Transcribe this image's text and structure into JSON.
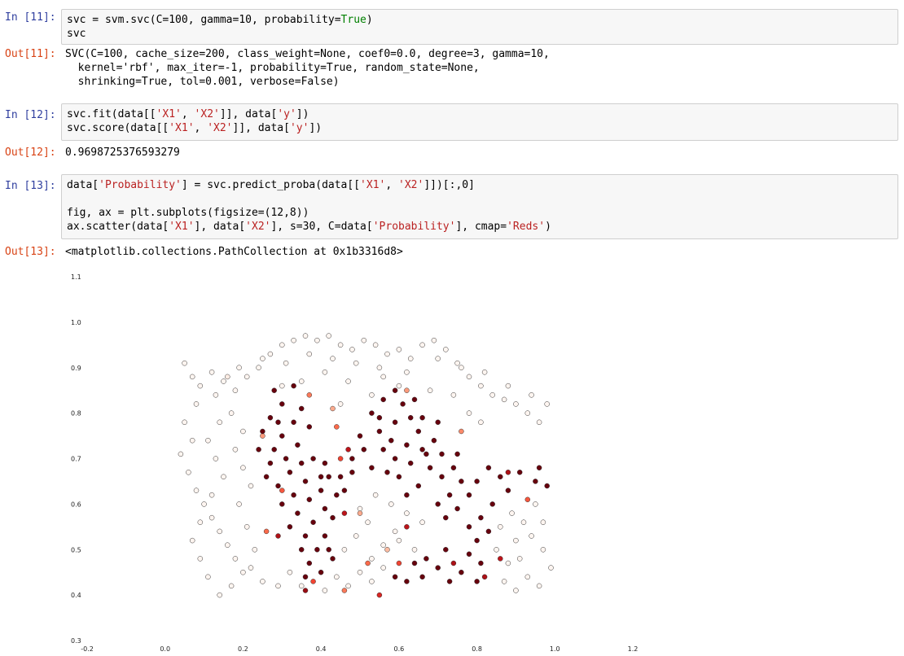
{
  "cells": [
    {
      "in_prompt": "In [11]:",
      "code": [
        [
          {
            "t": "svc = svm.svc(C=100, gamma=10, probability="
          },
          {
            "t": "True",
            "c": "kw"
          },
          {
            "t": ")"
          }
        ],
        [
          {
            "t": "svc"
          }
        ]
      ],
      "out_prompt": "Out[11]:",
      "output": [
        "SVC(C=100, cache_size=200, class_weight=None, coef0=0.0, degree=3, gamma=10,",
        "  kernel='rbf', max_iter=-1, probability=True, random_state=None,",
        "  shrinking=True, tol=0.001, verbose=False)"
      ]
    },
    {
      "in_prompt": "In [12]:",
      "code": [
        [
          {
            "t": "svc.fit(data[["
          },
          {
            "t": "'X1'",
            "c": "st"
          },
          {
            "t": ", "
          },
          {
            "t": "'X2'",
            "c": "st"
          },
          {
            "t": "]], data["
          },
          {
            "t": "'y'",
            "c": "st"
          },
          {
            "t": "])"
          }
        ],
        [
          {
            "t": "svc.score(data[["
          },
          {
            "t": "'X1'",
            "c": "st"
          },
          {
            "t": ", "
          },
          {
            "t": "'X2'",
            "c": "st"
          },
          {
            "t": "]], data["
          },
          {
            "t": "'y'",
            "c": "st"
          },
          {
            "t": "])"
          }
        ]
      ],
      "out_prompt": "Out[12]:",
      "output": [
        "0.9698725376593279"
      ]
    },
    {
      "in_prompt": "In [13]:",
      "code": [
        [
          {
            "t": "data["
          },
          {
            "t": "'Probability'",
            "c": "st"
          },
          {
            "t": "] = svc.predict_proba(data[["
          },
          {
            "t": "'X1'",
            "c": "st"
          },
          {
            "t": ", "
          },
          {
            "t": "'X2'",
            "c": "st"
          },
          {
            "t": "]])[:,0]"
          }
        ],
        [
          {
            "t": ""
          }
        ],
        [
          {
            "t": "fig, ax = plt.subplots(figsize=(12,8))"
          }
        ],
        [
          {
            "t": "ax.scatter(data["
          },
          {
            "t": "'X1'",
            "c": "st"
          },
          {
            "t": "], data["
          },
          {
            "t": "'X2'",
            "c": "st"
          },
          {
            "t": "], s=30, C=data["
          },
          {
            "t": "'Probability'",
            "c": "st"
          },
          {
            "t": "], cmap="
          },
          {
            "t": "'Reds'",
            "c": "st"
          },
          {
            "t": ")"
          }
        ]
      ],
      "out_prompt": "Out[13]:",
      "output": [
        "<matplotlib.collections.PathCollection at 0x1b3316d8>"
      ]
    }
  ],
  "chart_data": {
    "type": "scatter",
    "title": "",
    "xlabel": "",
    "ylabel": "",
    "xlim": [
      -0.2,
      1.2
    ],
    "ylim": [
      0.3,
      1.1
    ],
    "xticks": [
      "-0.2",
      "0.0",
      "0.2",
      "0.4",
      "0.6",
      "0.8",
      "1.0",
      "1.2"
    ],
    "yticks": [
      "0.3",
      "0.4",
      "0.5",
      "0.6",
      "0.7",
      "0.8",
      "0.9",
      "1.0",
      "1.1"
    ],
    "grid": false,
    "colormap": "Reds",
    "note_color_low": "#fff5f0",
    "note_color_high": "#67000d",
    "points": [
      [
        0.05,
        0.91,
        0
      ],
      [
        0.07,
        0.88,
        0
      ],
      [
        0.09,
        0.86,
        0
      ],
      [
        0.12,
        0.89,
        0
      ],
      [
        0.15,
        0.87,
        0
      ],
      [
        0.18,
        0.85,
        0
      ],
      [
        0.21,
        0.88,
        0
      ],
      [
        0.24,
        0.9,
        0
      ],
      [
        0.27,
        0.93,
        0
      ],
      [
        0.3,
        0.95,
        0
      ],
      [
        0.33,
        0.96,
        0
      ],
      [
        0.36,
        0.97,
        0
      ],
      [
        0.39,
        0.96,
        0
      ],
      [
        0.42,
        0.97,
        0
      ],
      [
        0.45,
        0.95,
        0
      ],
      [
        0.48,
        0.94,
        0
      ],
      [
        0.51,
        0.96,
        0
      ],
      [
        0.54,
        0.95,
        0
      ],
      [
        0.57,
        0.93,
        0
      ],
      [
        0.6,
        0.94,
        0
      ],
      [
        0.63,
        0.92,
        0
      ],
      [
        0.66,
        0.95,
        0
      ],
      [
        0.69,
        0.96,
        0
      ],
      [
        0.72,
        0.94,
        0
      ],
      [
        0.75,
        0.91,
        0
      ],
      [
        0.78,
        0.88,
        0
      ],
      [
        0.81,
        0.86,
        0
      ],
      [
        0.84,
        0.84,
        0
      ],
      [
        0.87,
        0.83,
        0
      ],
      [
        0.9,
        0.82,
        0
      ],
      [
        0.93,
        0.8,
        0
      ],
      [
        0.96,
        0.78,
        0
      ],
      [
        0.98,
        0.82,
        0
      ],
      [
        0.94,
        0.84,
        0
      ],
      [
        0.88,
        0.86,
        0
      ],
      [
        0.82,
        0.89,
        0
      ],
      [
        0.76,
        0.9,
        0
      ],
      [
        0.7,
        0.92,
        0
      ],
      [
        0.62,
        0.89,
        0
      ],
      [
        0.55,
        0.9,
        0
      ],
      [
        0.49,
        0.91,
        0
      ],
      [
        0.43,
        0.92,
        0
      ],
      [
        0.37,
        0.93,
        0
      ],
      [
        0.31,
        0.91,
        0
      ],
      [
        0.25,
        0.92,
        0
      ],
      [
        0.19,
        0.9,
        0
      ],
      [
        0.13,
        0.84,
        0
      ],
      [
        0.08,
        0.82,
        0
      ],
      [
        0.05,
        0.78,
        0
      ],
      [
        0.07,
        0.74,
        0
      ],
      [
        0.04,
        0.71,
        0
      ],
      [
        0.06,
        0.67,
        0
      ],
      [
        0.08,
        0.63,
        0
      ],
      [
        0.1,
        0.6,
        0
      ],
      [
        0.12,
        0.57,
        0
      ],
      [
        0.14,
        0.54,
        0
      ],
      [
        0.16,
        0.51,
        0
      ],
      [
        0.18,
        0.48,
        0
      ],
      [
        0.2,
        0.45,
        0
      ],
      [
        0.17,
        0.42,
        0
      ],
      [
        0.14,
        0.4,
        0
      ],
      [
        0.11,
        0.44,
        0
      ],
      [
        0.09,
        0.48,
        0
      ],
      [
        0.07,
        0.52,
        0
      ],
      [
        0.09,
        0.56,
        0
      ],
      [
        0.12,
        0.62,
        0
      ],
      [
        0.15,
        0.66,
        0
      ],
      [
        0.13,
        0.7,
        0
      ],
      [
        0.11,
        0.74,
        0
      ],
      [
        0.14,
        0.78,
        0
      ],
      [
        0.17,
        0.8,
        0
      ],
      [
        0.2,
        0.76,
        0
      ],
      [
        0.18,
        0.72,
        0
      ],
      [
        0.2,
        0.68,
        0
      ],
      [
        0.22,
        0.64,
        0
      ],
      [
        0.19,
        0.6,
        0
      ],
      [
        0.21,
        0.55,
        0
      ],
      [
        0.23,
        0.5,
        0
      ],
      [
        0.22,
        0.46,
        0
      ],
      [
        0.25,
        0.43,
        0
      ],
      [
        0.29,
        0.42,
        0
      ],
      [
        0.32,
        0.45,
        0
      ],
      [
        0.35,
        0.42,
        0
      ],
      [
        0.41,
        0.41,
        0
      ],
      [
        0.44,
        0.44,
        0
      ],
      [
        0.47,
        0.42,
        0
      ],
      [
        0.5,
        0.45,
        0
      ],
      [
        0.53,
        0.48,
        0
      ],
      [
        0.56,
        0.51,
        0
      ],
      [
        0.59,
        0.54,
        0
      ],
      [
        0.52,
        0.56,
        0
      ],
      [
        0.49,
        0.53,
        0
      ],
      [
        0.46,
        0.5,
        0
      ],
      [
        0.5,
        0.59,
        0
      ],
      [
        0.54,
        0.62,
        0
      ],
      [
        0.58,
        0.6,
        0
      ],
      [
        0.62,
        0.58,
        0
      ],
      [
        0.66,
        0.56,
        0
      ],
      [
        0.6,
        0.52,
        0
      ],
      [
        0.64,
        0.5,
        0
      ],
      [
        0.56,
        0.46,
        0
      ],
      [
        0.53,
        0.43,
        0
      ],
      [
        0.85,
        0.5,
        0
      ],
      [
        0.88,
        0.47,
        0
      ],
      [
        0.9,
        0.52,
        0
      ],
      [
        0.92,
        0.56,
        0
      ],
      [
        0.95,
        0.6,
        0
      ],
      [
        0.97,
        0.5,
        0
      ],
      [
        0.99,
        0.46,
        0
      ],
      [
        0.96,
        0.42,
        0
      ],
      [
        0.93,
        0.44,
        0
      ],
      [
        0.9,
        0.41,
        0
      ],
      [
        0.87,
        0.43,
        0
      ],
      [
        0.91,
        0.48,
        0
      ],
      [
        0.94,
        0.53,
        0
      ],
      [
        0.97,
        0.56,
        0
      ],
      [
        0.86,
        0.55,
        0
      ],
      [
        0.89,
        0.58,
        0
      ],
      [
        0.56,
        0.88,
        0
      ],
      [
        0.47,
        0.87,
        0
      ],
      [
        0.41,
        0.89,
        0
      ],
      [
        0.35,
        0.87,
        0
      ],
      [
        0.3,
        0.86,
        0
      ],
      [
        0.45,
        0.82,
        0
      ],
      [
        0.53,
        0.84,
        0
      ],
      [
        0.6,
        0.86,
        0
      ],
      [
        0.68,
        0.85,
        0
      ],
      [
        0.74,
        0.84,
        0
      ],
      [
        0.78,
        0.8,
        0
      ],
      [
        0.81,
        0.78,
        0
      ],
      [
        0.16,
        0.88,
        0.05
      ],
      [
        0.43,
        0.81,
        0.3
      ],
      [
        0.25,
        0.75,
        0.35
      ],
      [
        0.44,
        0.77,
        0.5
      ],
      [
        0.37,
        0.84,
        0.45
      ],
      [
        0.76,
        0.76,
        0.4
      ],
      [
        0.62,
        0.85,
        0.35
      ],
      [
        0.57,
        0.5,
        0.25
      ],
      [
        0.5,
        0.58,
        0.3
      ],
      [
        0.26,
        0.54,
        0.5
      ],
      [
        0.3,
        0.63,
        0.55
      ],
      [
        0.6,
        0.47,
        0.6
      ],
      [
        0.52,
        0.47,
        0.5
      ],
      [
        0.46,
        0.41,
        0.45
      ],
      [
        0.38,
        0.43,
        0.6
      ],
      [
        0.93,
        0.61,
        0.55
      ],
      [
        0.45,
        0.7,
        0.6
      ],
      [
        0.55,
        0.4,
        0.7
      ],
      [
        0.28,
        0.85,
        1
      ],
      [
        0.3,
        0.82,
        1
      ],
      [
        0.27,
        0.79,
        1
      ],
      [
        0.25,
        0.76,
        1
      ],
      [
        0.28,
        0.72,
        1
      ],
      [
        0.3,
        0.75,
        1
      ],
      [
        0.33,
        0.78,
        1
      ],
      [
        0.35,
        0.81,
        1
      ],
      [
        0.37,
        0.77,
        1
      ],
      [
        0.34,
        0.73,
        1
      ],
      [
        0.31,
        0.7,
        1
      ],
      [
        0.27,
        0.69,
        1
      ],
      [
        0.24,
        0.72,
        1
      ],
      [
        0.26,
        0.66,
        1
      ],
      [
        0.29,
        0.64,
        1
      ],
      [
        0.32,
        0.67,
        1
      ],
      [
        0.35,
        0.69,
        1
      ],
      [
        0.38,
        0.7,
        1
      ],
      [
        0.36,
        0.65,
        1
      ],
      [
        0.33,
        0.62,
        1
      ],
      [
        0.3,
        0.6,
        1
      ],
      [
        0.34,
        0.58,
        1
      ],
      [
        0.37,
        0.61,
        1
      ],
      [
        0.4,
        0.63,
        1
      ],
      [
        0.42,
        0.66,
        1
      ],
      [
        0.44,
        0.62,
        1
      ],
      [
        0.41,
        0.59,
        1
      ],
      [
        0.38,
        0.56,
        1
      ],
      [
        0.36,
        0.53,
        1
      ],
      [
        0.39,
        0.5,
        1
      ],
      [
        0.41,
        0.53,
        1
      ],
      [
        0.43,
        0.57,
        1
      ],
      [
        0.46,
        0.63,
        1
      ],
      [
        0.48,
        0.67,
        1
      ],
      [
        0.45,
        0.66,
        1
      ],
      [
        0.37,
        0.47,
        1
      ],
      [
        0.36,
        0.44,
        1
      ],
      [
        0.4,
        0.45,
        1
      ],
      [
        0.43,
        0.48,
        1
      ],
      [
        0.48,
        0.7,
        1
      ],
      [
        0.53,
        0.68,
        1
      ],
      [
        0.56,
        0.72,
        1
      ],
      [
        0.55,
        0.76,
        1
      ],
      [
        0.53,
        0.8,
        1
      ],
      [
        0.56,
        0.83,
        1
      ],
      [
        0.59,
        0.85,
        1
      ],
      [
        0.61,
        0.82,
        1
      ],
      [
        0.63,
        0.79,
        1
      ],
      [
        0.65,
        0.76,
        1
      ],
      [
        0.62,
        0.73,
        1
      ],
      [
        0.59,
        0.7,
        1
      ],
      [
        0.57,
        0.67,
        1
      ],
      [
        0.6,
        0.66,
        1
      ],
      [
        0.63,
        0.69,
        1
      ],
      [
        0.66,
        0.72,
        1
      ],
      [
        0.69,
        0.74,
        1
      ],
      [
        0.71,
        0.71,
        1
      ],
      [
        0.68,
        0.68,
        1
      ],
      [
        0.71,
        0.66,
        1
      ],
      [
        0.74,
        0.68,
        1
      ],
      [
        0.76,
        0.65,
        1
      ],
      [
        0.73,
        0.62,
        1
      ],
      [
        0.7,
        0.6,
        1
      ],
      [
        0.72,
        0.57,
        1
      ],
      [
        0.75,
        0.59,
        1
      ],
      [
        0.78,
        0.62,
        1
      ],
      [
        0.8,
        0.65,
        1
      ],
      [
        0.83,
        0.68,
        1
      ],
      [
        0.86,
        0.66,
        1
      ],
      [
        0.88,
        0.63,
        1
      ],
      [
        0.84,
        0.6,
        1
      ],
      [
        0.81,
        0.57,
        1
      ],
      [
        0.78,
        0.55,
        1
      ],
      [
        0.8,
        0.52,
        1
      ],
      [
        0.83,
        0.54,
        1
      ],
      [
        0.78,
        0.49,
        1
      ],
      [
        0.81,
        0.47,
        1
      ],
      [
        0.8,
        0.43,
        1
      ],
      [
        0.76,
        0.45,
        1
      ],
      [
        0.73,
        0.43,
        1
      ],
      [
        0.7,
        0.46,
        1
      ],
      [
        0.67,
        0.48,
        1
      ],
      [
        0.64,
        0.47,
        1
      ],
      [
        0.66,
        0.44,
        1
      ],
      [
        0.62,
        0.43,
        1
      ],
      [
        0.59,
        0.44,
        1
      ],
      [
        0.62,
        0.62,
        1
      ],
      [
        0.65,
        0.64,
        1
      ],
      [
        0.91,
        0.67,
        1
      ],
      [
        0.95,
        0.65,
        1
      ],
      [
        0.98,
        0.64,
        1
      ],
      [
        0.96,
        0.68,
        1
      ],
      [
        0.59,
        0.78,
        1
      ],
      [
        0.58,
        0.74,
        1
      ],
      [
        0.66,
        0.79,
        1
      ],
      [
        0.64,
        0.83,
        1
      ],
      [
        0.51,
        0.72,
        1
      ],
      [
        0.5,
        0.75,
        1
      ],
      [
        0.7,
        0.78,
        1
      ],
      [
        0.67,
        0.71,
        1
      ],
      [
        0.75,
        0.71,
        1
      ],
      [
        0.33,
        0.86,
        1
      ],
      [
        0.41,
        0.69,
        1
      ],
      [
        0.32,
        0.55,
        1
      ],
      [
        0.35,
        0.5,
        1
      ],
      [
        0.42,
        0.5,
        1
      ],
      [
        0.4,
        0.66,
        1
      ],
      [
        0.29,
        0.78,
        1
      ],
      [
        0.55,
        0.79,
        1
      ],
      [
        0.72,
        0.5,
        1
      ],
      [
        0.82,
        0.44,
        0.85
      ],
      [
        0.74,
        0.47,
        0.85
      ],
      [
        0.29,
        0.53,
        0.85
      ],
      [
        0.47,
        0.72,
        0.8
      ],
      [
        0.62,
        0.55,
        0.8
      ],
      [
        0.86,
        0.48,
        0.8
      ],
      [
        0.88,
        0.67,
        0.85
      ],
      [
        0.36,
        0.41,
        0.9
      ],
      [
        0.46,
        0.58,
        0.8
      ]
    ]
  }
}
